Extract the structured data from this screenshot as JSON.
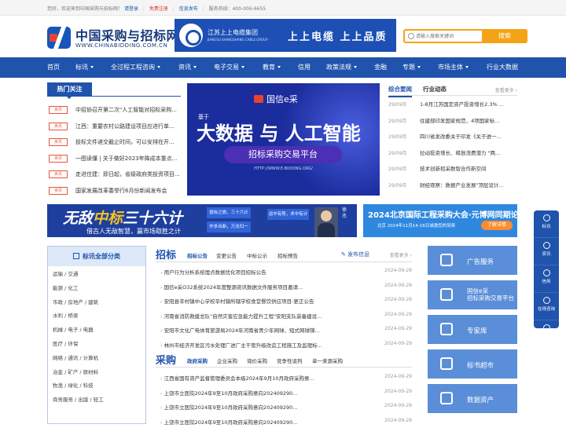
{
  "topbar": {
    "welcome": "您好，欢迎来到中国采购与招标网！",
    "login": "请登录",
    "register": "免费注册",
    "publish": "信息发布",
    "hotline": "服务热线：400-006-6655"
  },
  "logo": {
    "cn": "中国采购与招标网",
    "en": "WWW.CHINABIDDING.COM.CN"
  },
  "ad_top": {
    "company": "江苏上上电缆集团",
    "company_en": "JIANGSU SHANGSHANG CABLE GROUP",
    "slogan": "上上电缆  上上品质"
  },
  "search": {
    "placeholder": "请输入搜索关键词",
    "button": "搜索"
  },
  "nav": [
    {
      "label": "首页",
      "dd": false
    },
    {
      "label": "标讯",
      "dd": true
    },
    {
      "label": "全过程工程咨询",
      "dd": true
    },
    {
      "label": "资讯",
      "dd": true
    },
    {
      "label": "电子交易",
      "dd": true
    },
    {
      "label": "教育",
      "dd": true
    },
    {
      "label": "信用",
      "dd": false
    },
    {
      "label": "政策法规",
      "dd": true
    },
    {
      "label": "金融",
      "dd": false
    },
    {
      "label": "专题",
      "dd": true
    },
    {
      "label": "市场主体",
      "dd": true
    },
    {
      "label": "行业大数据",
      "dd": false
    }
  ],
  "hot": {
    "title": "热门关注",
    "items": [
      {
        "tag": "资讯",
        "text": "中招协召开第二次\"人工智能对招标采购..."
      },
      {
        "tag": "资讯",
        "text": "江西：重要农村公路建设项目应进行单..."
      },
      {
        "tag": "资讯",
        "text": "投标文件递交截止时间，可以安排在开..."
      },
      {
        "tag": "资讯",
        "text": "一图读懂 | 关于做好2023年降成本重点..."
      },
      {
        "tag": "资讯",
        "text": "走进住建：即日起，省级政府类投资项目..."
      },
      {
        "tag": "资讯",
        "text": "国家发展改革委举行6月份新闻发布会"
      }
    ]
  },
  "big_banner": {
    "brand": "国信e采",
    "ji": "基于",
    "main": "大数据 与 人工智能",
    "pill": "招标采购交易平台",
    "url": "HTTP://WWW.E-BIDDING.ORG/"
  },
  "news": {
    "tabs": [
      "综合要闻",
      "行业动态"
    ],
    "more": "查看更多 ›",
    "items": [
      {
        "date": "29/09月",
        "text": "1-8月江苏国定资产投资增长2.3% ..."
      },
      {
        "date": "29/09月",
        "text": "住建部印发国家规范，4项国家标..."
      },
      {
        "date": "29/09月",
        "text": "四川省发改委关于印发《关于进一..."
      },
      {
        "date": "29/09月",
        "text": "拉动投资增长、释放消费潜力 \"两..."
      },
      {
        "date": "29/09月",
        "text": "技术创新招采数智合作新空间"
      },
      {
        "date": "29/09月",
        "text": "财经观察：数据产业发展\"顶层设计..."
      }
    ]
  },
  "mid_banner1": {
    "pre": "无敌",
    "hl": "中标",
    "post": "三十六计",
    "sub": "借古人无敌智慧，赢市场取胜之计",
    "b1": "投标之旅，三十六计",
    "b2": "作多出新，万法归一",
    "b3": "运中有势，术中有计",
    "name": "徐杰"
  },
  "mid_banner2": {
    "title": "2024北京国际工程采购大会·元博网同期论坛",
    "sub": "北京  2024年11月14-16日诚邀您的到来",
    "btn": "了解详情"
  },
  "cat": {
    "title": "标讯全部分类",
    "items": [
      "运输 / 交通",
      "能源 / 化工",
      "市政 / 房地产 / 建筑",
      "水利 / 桥梁",
      "机械 / 电子 / 电器",
      "医疗 / 环保",
      "网络 / 通讯 / 计算机",
      "冶金 / 矿产 / 原材料",
      "牧渔 / 绿化 / 科技",
      "商务服务 / 出版 / 轻工"
    ]
  },
  "bidding": {
    "title": "招标",
    "tabs": [
      "招标公告",
      "变更公告",
      "中标公示",
      "招标预告"
    ],
    "publish": "发布信息",
    "more": "查看更多 ›",
    "items": [
      {
        "text": "用户行为分析系统埋点数据优化项目招标公告",
        "date": "2024-09-29"
      },
      {
        "text": "国信e采O32系统2024年度整源资讯数据文件服务项目邀请...",
        "date": "2024-09-29"
      },
      {
        "text": "安阳县辛村镇中心学校辛村镇所辖学校食堂餐饮供应项目-更正公告",
        "date": "2024-09-29"
      },
      {
        "text": "河南省消防救援总队\"自然灾害应急能力提升工程\"安阳支队装备建设...",
        "date": "2024-09-29"
      },
      {
        "text": "安阳市文化广电体育旅游局2024年河南省青少年网球、短式网球锦...",
        "date": "2024-09-29"
      },
      {
        "text": "林州市经济开发区污水处理厂进厂主干管升级改造工程施工及监理标...",
        "date": "2024-09-29"
      }
    ]
  },
  "procurement": {
    "title": "采购",
    "tabs": [
      "政府采购",
      "企业采购",
      "询价采购",
      "竞争性谈判",
      "单一来源采购"
    ],
    "items": [
      {
        "text": "江西省国有资产监督管理委员会本级2024年9月10月政府采购意...",
        "date": "2024-09-29"
      },
      {
        "text": "上饶市立医院2024年9至10月政府采购意向202409290...",
        "date": "2024-09-29"
      },
      {
        "text": "上饶市立医院2024年9至10月政府采购意向202409290...",
        "date": "2024-09-29"
      },
      {
        "text": "上饶市立医院2024年9至10月政府采购意向202409290...",
        "date": "2024-09-29"
      }
    ]
  },
  "side": [
    {
      "t1": "广告服务",
      "t2": ""
    },
    {
      "t1": "国信e采",
      "t2": "招标采购交易平台"
    },
    {
      "t1": "专家库",
      "t2": ""
    },
    {
      "t1": "标书超市",
      "t2": ""
    },
    {
      "t1": "数据资产",
      "t2": ""
    }
  ],
  "float": [
    "标讯",
    "资讯",
    "信用",
    "在线咨询",
    "回到顶部"
  ]
}
